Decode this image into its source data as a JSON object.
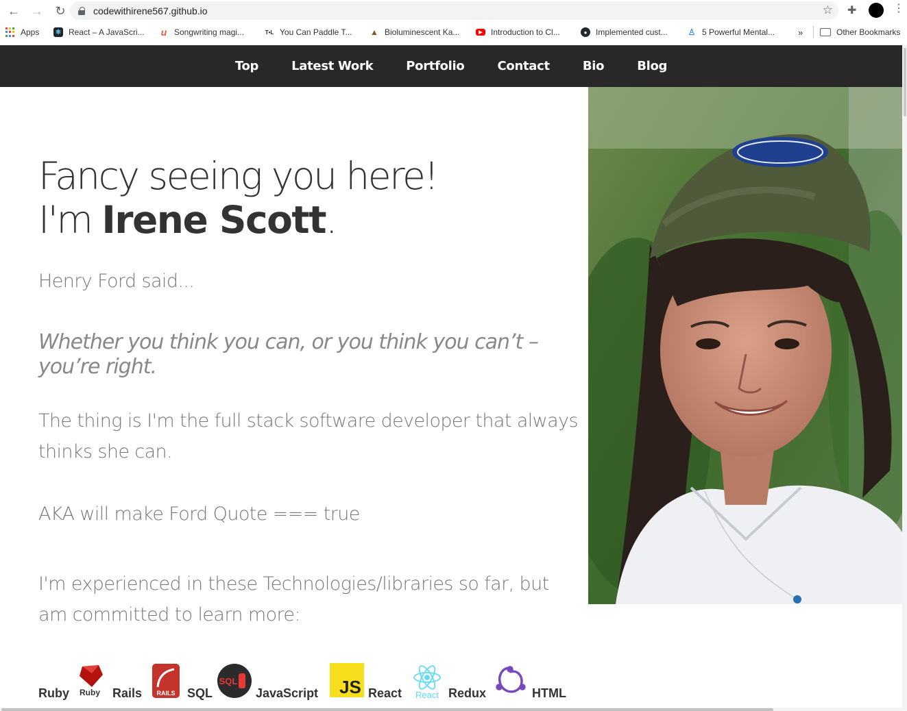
{
  "browser": {
    "url": "codewithirene567.github.io",
    "bookmarks": [
      {
        "label": "Apps",
        "icon": "apps-grid-icon"
      },
      {
        "label": "React – A JavaScri...",
        "icon": "react-icon"
      },
      {
        "label": "Songwriting magi...",
        "icon": "udemy-icon"
      },
      {
        "label": "You Can Paddle T...",
        "icon": "tl-icon"
      },
      {
        "label": "Bioluminescent Ka...",
        "icon": "kayak-icon"
      },
      {
        "label": "Introduction to Cl...",
        "icon": "youtube-icon"
      },
      {
        "label": "Implemented cust...",
        "icon": "github-icon"
      },
      {
        "label": "5 Powerful Mental...",
        "icon": "asana-icon"
      }
    ],
    "overflow_label": "»",
    "other_bookmarks": "Other Bookmarks"
  },
  "nav": {
    "items": [
      "Top",
      "Latest Work",
      "Portfolio",
      "Contact",
      "Bio",
      "Blog"
    ]
  },
  "hero": {
    "line1": "Fancy seeing you here!",
    "line2_prefix": "I'm ",
    "name": "Irene Scott",
    "line2_suffix": "."
  },
  "body": {
    "said": "Henry Ford said...",
    "quote": "Whether you think you can, or you think you can’t – you’re right.",
    "thing": "The thing is I'm the full stack software developer that always thinks she can.",
    "aka": "AKA will make Ford Quote === true",
    "experienced": "I'm experienced in these Technologies/libraries so far, but am committed to learn more:"
  },
  "technologies": {
    "labels": [
      "Ruby",
      "Rails",
      "SQL",
      "JavaScript",
      "React",
      "Redux",
      "HTML"
    ],
    "logo_texts": {
      "ruby": "Ruby",
      "rails": "RAILS",
      "sql": "SQL",
      "js": "JS",
      "react": "React"
    },
    "colors": {
      "ruby": "#b3120f",
      "rails": "#c4332c",
      "js": "#f7df1e",
      "react": "#61dafb",
      "redux": "#764abc"
    }
  },
  "colors": {
    "nav_bg": "#282828",
    "accent_text": "#333333",
    "muted_text": "#777777"
  }
}
